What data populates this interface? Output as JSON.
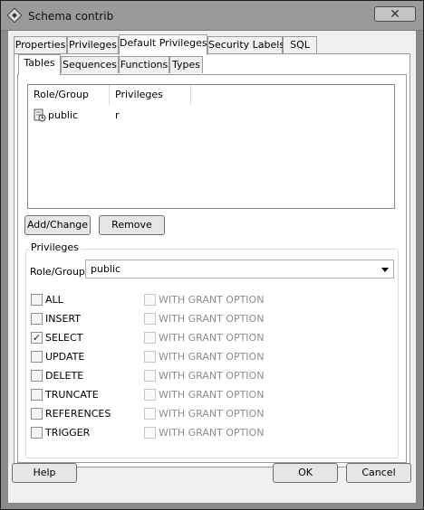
{
  "window": {
    "title": "Schema contrib",
    "close_glyph": "✕"
  },
  "tabs": [
    "Properties",
    "Privileges",
    "Default Privileges",
    "Security Labels",
    "SQL"
  ],
  "subtabs": [
    "Tables",
    "Sequences",
    "Functions",
    "Types"
  ],
  "list": {
    "columns": [
      "Role/Group",
      "Privileges"
    ],
    "rows": [
      {
        "role": "public",
        "privileges": "r",
        "icon": "group-icon"
      }
    ]
  },
  "actions": {
    "add_change": "Add/Change",
    "remove": "Remove"
  },
  "privileges": {
    "title": "Privileges",
    "role_label": "Role/Group",
    "role_value": "public",
    "grant_option_label": "WITH GRANT OPTION",
    "items": [
      {
        "name": "ALL",
        "checked": false
      },
      {
        "name": "INSERT",
        "checked": false
      },
      {
        "name": "SELECT",
        "checked": true
      },
      {
        "name": "UPDATE",
        "checked": false
      },
      {
        "name": "DELETE",
        "checked": false
      },
      {
        "name": "TRUNCATE",
        "checked": false
      },
      {
        "name": "REFERENCES",
        "checked": false
      },
      {
        "name": "TRIGGER",
        "checked": false
      }
    ]
  },
  "footer": {
    "help": "Help",
    "ok": "OK",
    "cancel": "Cancel"
  }
}
